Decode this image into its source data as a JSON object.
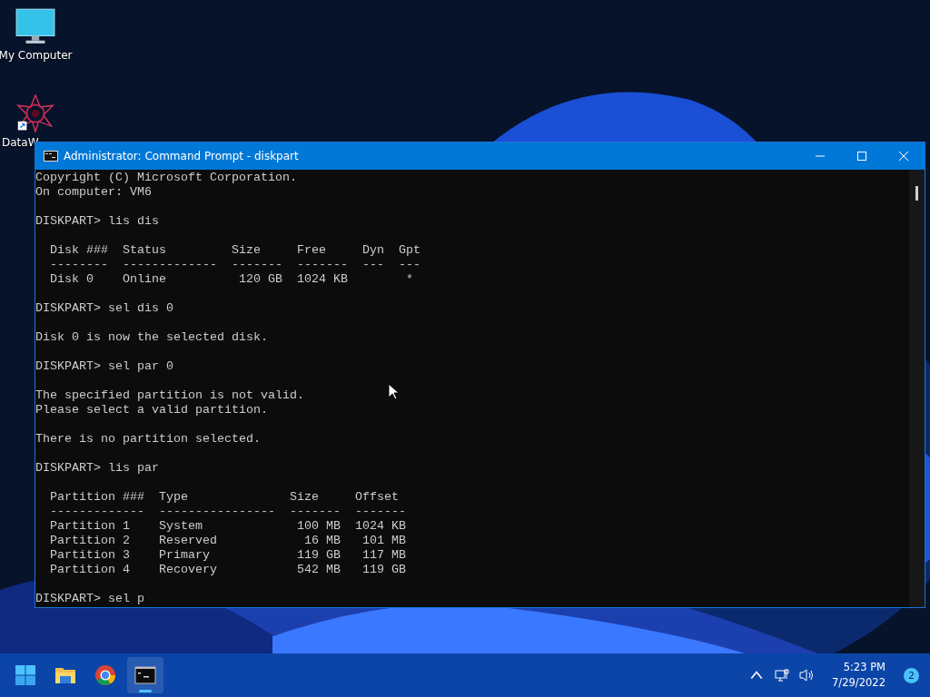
{
  "desktop_icons": [
    {
      "kind": "computer",
      "label": "My Computer"
    },
    {
      "kind": "mandala",
      "label": "DataW"
    }
  ],
  "window": {
    "title": "Administrator: Command Prompt - diskpart",
    "blocks": [
      [
        "Copyright (C) Microsoft Corporation.",
        "On computer: VM6"
      ],
      [
        "DISKPART> lis dis"
      ],
      [
        "  Disk ###  Status         Size     Free     Dyn  Gpt",
        "  --------  -------------  -------  -------  ---  ---",
        "  Disk 0    Online          120 GB  1024 KB        *"
      ],
      [
        "DISKPART> sel dis 0"
      ],
      [
        "Disk 0 is now the selected disk."
      ],
      [
        "DISKPART> sel par 0"
      ],
      [
        "The specified partition is not valid.",
        "Please select a valid partition."
      ],
      [
        "There is no partition selected."
      ],
      [
        "DISKPART> lis par"
      ],
      [
        "  Partition ###  Type              Size     Offset",
        "  -------------  ----------------  -------  -------",
        "  Partition 1    System             100 MB  1024 KB",
        "  Partition 2    Reserved            16 MB   101 MB",
        "  Partition 3    Primary            119 GB   117 MB",
        "  Partition 4    Recovery           542 MB   119 GB"
      ],
      [
        "DISKPART> sel p"
      ]
    ]
  },
  "taskbar": {
    "apps": [
      {
        "kind": "start",
        "selected": false
      },
      {
        "kind": "folder",
        "selected": false
      },
      {
        "kind": "browser",
        "selected": false
      },
      {
        "kind": "terminal",
        "selected": true
      }
    ],
    "time": "5:23 PM",
    "date": "7/29/2022",
    "notifications": "2"
  }
}
